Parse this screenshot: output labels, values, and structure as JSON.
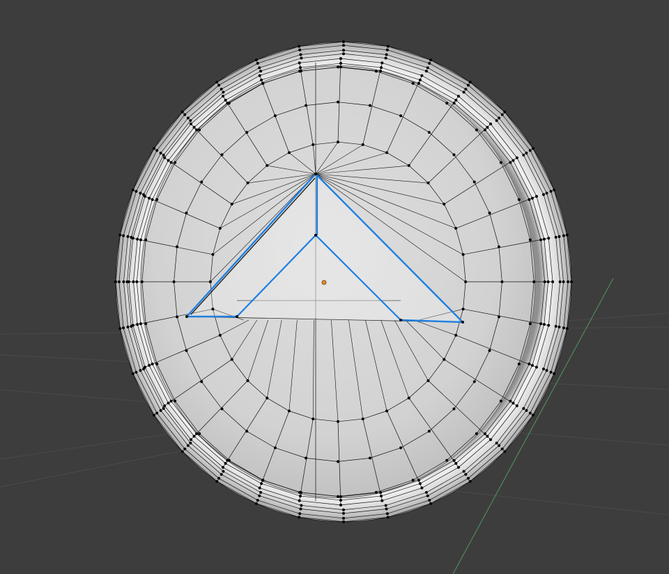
{
  "viewport": {
    "background_color": "#3d3d3d",
    "grid_color": "#4a4a4a",
    "y_axis_color": "#4f8a5b"
  },
  "mesh": {
    "object": "cylinder-coin",
    "face_color": "#cdcdcd",
    "face_color_light": "#dcdcdc",
    "rim_color_light": "#eeeeee",
    "rim_color_dark": "#9a9a9a",
    "wire_color": "#111111",
    "vertex_color": "#000000",
    "selection_color": "#1e7fe0",
    "origin_color": "#e88b2a",
    "ring_segments": 32,
    "selection": "triangle-edge-loop"
  }
}
